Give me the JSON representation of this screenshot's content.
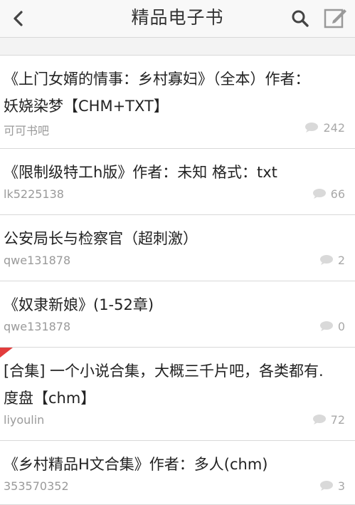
{
  "header": {
    "title": "精品电子书",
    "back_icon": "chevron-left-icon",
    "search_icon": "search-icon",
    "compose_icon": "compose-icon"
  },
  "items": [
    {
      "title": "《上门女婿的情事：乡村寡妇》（全本）作者：\n妖娆染梦【CHM+TXT】",
      "author": "可可书吧",
      "count": "242",
      "flag": false
    },
    {
      "title": "《限制级特工h版》作者：未知 格式：txt",
      "author": "lk5225138",
      "count": "66",
      "flag": false
    },
    {
      "title": "公安局长与检察官（超刺激）",
      "author": "qwe131878",
      "count": "2",
      "flag": false
    },
    {
      "title": "《奴隶新娘》(1-52章)",
      "author": "qwe131878",
      "count": "0",
      "flag": false
    },
    {
      "title": "[合集] 一个小说合集，大概三千片吧，各类都有.\n度盘【chm】",
      "author": "liyoulin",
      "count": "72",
      "flag": true
    },
    {
      "title": "《乡村精品H文合集》作者：多人(chm)",
      "author": "353570352",
      "count": "3",
      "flag": false
    }
  ],
  "colors": {
    "accent": "#e23c3c",
    "meta": "#9a9a9a"
  }
}
